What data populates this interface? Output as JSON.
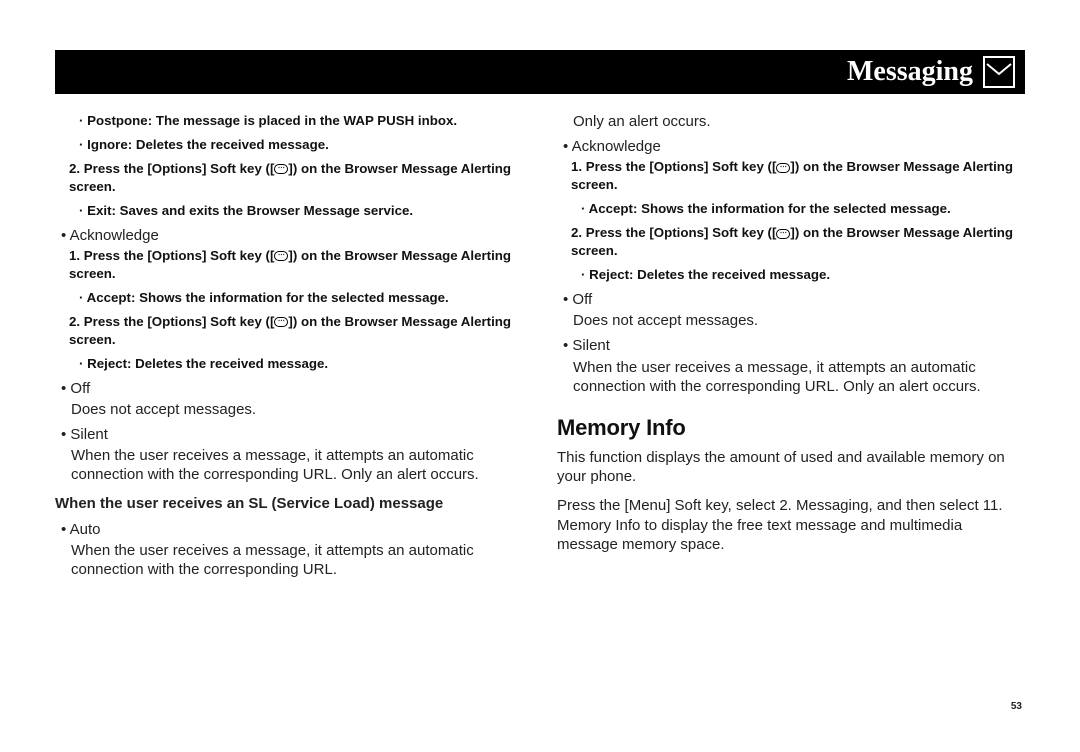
{
  "header": {
    "title": "Messaging",
    "icon": "envelope-icon"
  },
  "page_number": "53",
  "left": {
    "postpone": "· Postpone: The message is placed in the WAP PUSH inbox.",
    "ignore": "· Ignore: Deletes the received message.",
    "step2a_pre": "2. Press the [Options] Soft key ([",
    "step2a_post": "]) on the Browser Message Alerting screen.",
    "exit": "· Exit: Saves and exits the Browser Message service.",
    "ack_label": "• Acknowledge",
    "ack_s1_pre": "1. Press the [Options] Soft key ([",
    "ack_s1_post": "]) on the Browser Message Alerting screen.",
    "accept": "· Accept: Shows the information for the selected message.",
    "ack_s2_pre": "2. Press the [Options] Soft key ([",
    "ack_s2_post": "]) on the Browser Message Alerting screen.",
    "reject": "· Reject: Deletes the received message.",
    "off_label": "• Off",
    "off_body": "Does not accept messages.",
    "silent_label": "• Silent",
    "silent_body": "When the user receives a message, it attempts an automatic connection with the corresponding URL. Only an alert occurs.",
    "sl_head": "When the user receives an SL (Service Load) message",
    "auto_label": "• Auto",
    "auto_body": "When the user receives a message, it attempts an automatic connection with the corresponding URL."
  },
  "right": {
    "only_alert": "Only an alert occurs.",
    "ack_label": "• Acknowledge",
    "ack_s1_pre": "1. Press the [Options] Soft key ([",
    "ack_s1_post": "]) on the Browser Message Alerting screen.",
    "accept": "· Accept: Shows the information for the selected message.",
    "ack_s2_pre": "2. Press the [Options] Soft key ([",
    "ack_s2_post": "]) on the Browser Message Alerting screen.",
    "reject": "· Reject: Deletes the received message.",
    "off_label": "• Off",
    "off_body": "Does not accept messages.",
    "silent_label": "• Silent",
    "silent_body": "When the user receives a message, it attempts an automatic connection with the corresponding URL. Only an alert occurs.",
    "mem_head": "Memory Info",
    "mem_p1": "This function displays the amount of used and available memory on your phone.",
    "mem_p2": "Press the [Menu] Soft key, select 2. Messaging, and then select 11. Memory Info to display the free text message and multimedia message memory space."
  }
}
